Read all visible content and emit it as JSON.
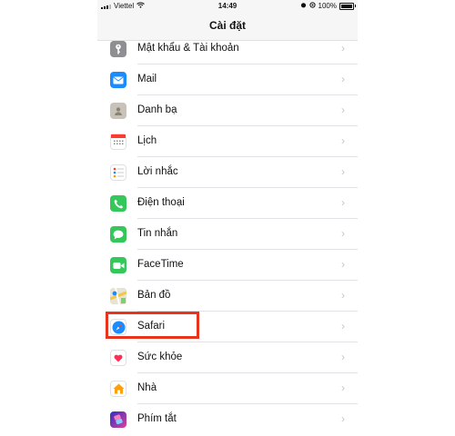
{
  "status_bar": {
    "carrier": "Viettel",
    "time": "14:49",
    "battery": "100%"
  },
  "nav": {
    "title": "Cài đặt"
  },
  "items": [
    {
      "label": "Mật khẩu & Tài khoản",
      "icon": "key-icon",
      "color": "#8e8e93"
    },
    {
      "label": "Mail",
      "icon": "mail-icon",
      "color": "#1a8cff"
    },
    {
      "label": "Danh bạ",
      "icon": "contacts-icon",
      "color": "#b8b2a8"
    },
    {
      "label": "Lịch",
      "icon": "calendar-icon",
      "color": "#ffffff"
    },
    {
      "label": "Lời nhắc",
      "icon": "reminders-icon",
      "color": "#ffffff"
    },
    {
      "label": "Điện thoại",
      "icon": "phone-icon",
      "color": "#34c759"
    },
    {
      "label": "Tin nhắn",
      "icon": "messages-icon",
      "color": "#34c759"
    },
    {
      "label": "FaceTime",
      "icon": "facetime-icon",
      "color": "#34c759"
    },
    {
      "label": "Bản đồ",
      "icon": "maps-icon",
      "color": "#6ac36a"
    },
    {
      "label": "Safari",
      "icon": "safari-icon",
      "color": "#1a8cff"
    },
    {
      "label": "Sức khỏe",
      "icon": "health-icon",
      "color": "#ffffff"
    },
    {
      "label": "Nhà",
      "icon": "home-icon",
      "color": "#ffffff"
    },
    {
      "label": "Phím tắt",
      "icon": "shortcuts-icon",
      "color": "#5856d6"
    }
  ],
  "highlight": {
    "target": "Safari",
    "color": "#e8341c"
  }
}
